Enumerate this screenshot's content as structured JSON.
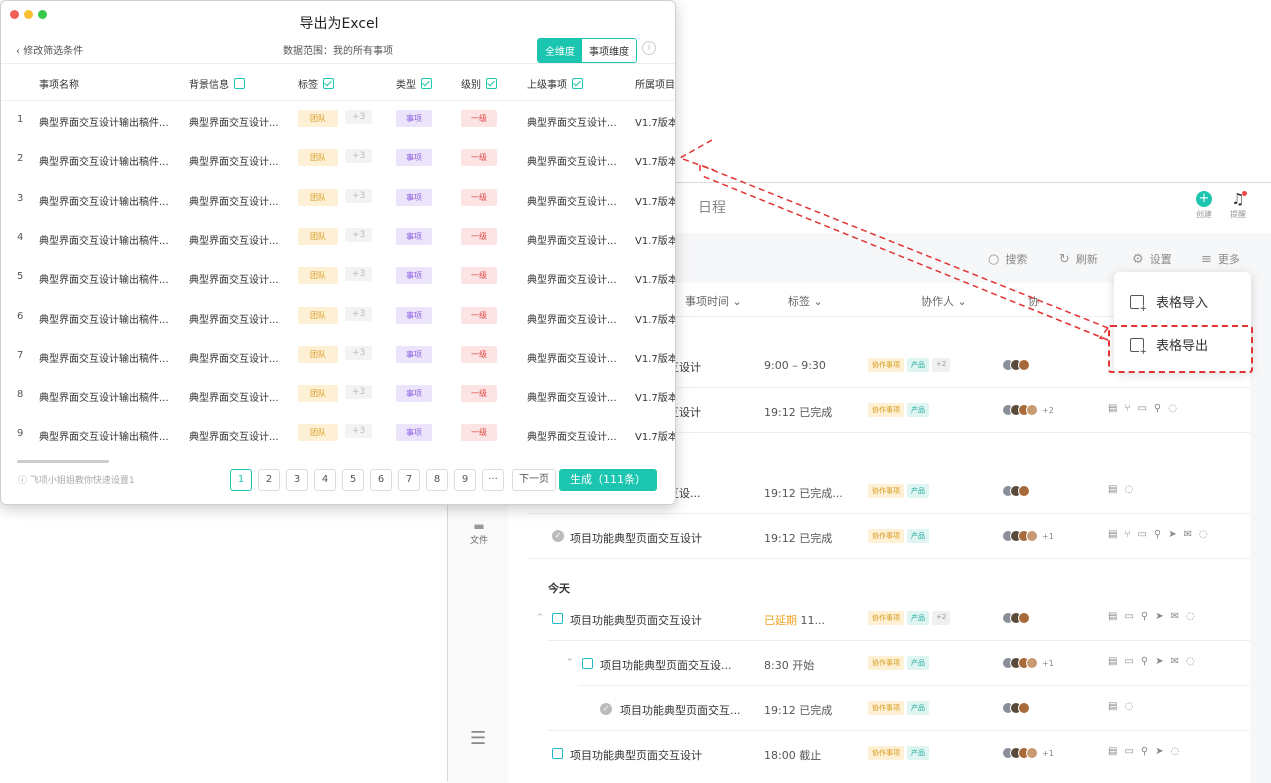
{
  "dialog": {
    "title": "导出为Excel",
    "back_label": "修改筛选条件",
    "range_label": "数据范围：我的所有事项",
    "seg_all": "全维度",
    "seg_item": "事项维度",
    "headers": [
      "事项名称",
      "背景信息",
      "标签",
      "类型",
      "级别",
      "上级事项",
      "所属项目"
    ],
    "rows": [
      {
        "n": "1",
        "name": "典型界面交互设计输出稿件...",
        "bg": "典型界面交互设计...",
        "tag1": "团队",
        "tag2": "+3",
        "type": "事项",
        "level": "一级",
        "parent": "典型界面交互设计...",
        "proj": "V1.7版本"
      },
      {
        "n": "2",
        "name": "典型界面交互设计输出稿件...",
        "bg": "典型界面交互设计...",
        "tag1": "团队",
        "tag2": "+3",
        "type": "事项",
        "level": "一级",
        "parent": "典型界面交互设计...",
        "proj": "V1.7版本"
      },
      {
        "n": "3",
        "name": "典型界面交互设计输出稿件...",
        "bg": "典型界面交互设计...",
        "tag1": "团队",
        "tag2": "+3",
        "type": "事项",
        "level": "一级",
        "parent": "典型界面交互设计...",
        "proj": "V1.7版本"
      },
      {
        "n": "4",
        "name": "典型界面交互设计输出稿件...",
        "bg": "典型界面交互设计...",
        "tag1": "团队",
        "tag2": "+3",
        "type": "事项",
        "level": "一级",
        "parent": "典型界面交互设计...",
        "proj": "V1.7版本"
      },
      {
        "n": "5",
        "name": "典型界面交互设计输出稿件...",
        "bg": "典型界面交互设计...",
        "tag1": "团队",
        "tag2": "+3",
        "type": "事项",
        "level": "一级",
        "parent": "典型界面交互设计...",
        "proj": "V1.7版本"
      },
      {
        "n": "6",
        "name": "典型界面交互设计输出稿件...",
        "bg": "典型界面交互设计...",
        "tag1": "团队",
        "tag2": "+3",
        "type": "事项",
        "level": "一级",
        "parent": "典型界面交互设计...",
        "proj": "V1.7版本"
      },
      {
        "n": "7",
        "name": "典型界面交互设计输出稿件...",
        "bg": "典型界面交互设计...",
        "tag1": "团队",
        "tag2": "+3",
        "type": "事项",
        "level": "一级",
        "parent": "典型界面交互设计...",
        "proj": "V1.7版本"
      },
      {
        "n": "8",
        "name": "典型界面交互设计输出稿件...",
        "bg": "典型界面交互设计...",
        "tag1": "团队",
        "tag2": "+3",
        "type": "事项",
        "level": "一级",
        "parent": "典型界面交互设计...",
        "proj": "V1.7版本"
      },
      {
        "n": "9",
        "name": "典型界面交互设计输出稿件...",
        "bg": "典型界面交互设计...",
        "tag1": "团队",
        "tag2": "+3",
        "type": "事项",
        "level": "一级",
        "parent": "典型界面交互设计...",
        "proj": "V1.7版本"
      }
    ],
    "tip": "飞项小姐姐教你快速设置1",
    "pages": [
      "1",
      "2",
      "3",
      "4",
      "5",
      "6",
      "7",
      "8",
      "9",
      "···",
      "下一页"
    ],
    "generate_label": "生成（111条）"
  },
  "app": {
    "nav_schedule": "日程",
    "create_label": "创建",
    "remind_label": "提醒",
    "search_label": "搜索",
    "refresh_label": "刷新",
    "settings_label": "设置",
    "more_label": "更多",
    "col_time": "事项时间 ⌄",
    "col_tag": "标签 ⌄",
    "col_collab": "协作人 ⌄",
    "col_extra": "协",
    "file_label": "文件",
    "today_label": "今天",
    "menu": {
      "import": "表格导入",
      "export": "表格导出"
    },
    "tag_collab": "协作事项",
    "tag_product": "产品",
    "rows": [
      {
        "name": "互设计",
        "time": "9:00 – 9:30"
      },
      {
        "name": "互设计",
        "time": "19:12 已完成"
      },
      {
        "name": "互设...",
        "time": "19:12 已完成..."
      },
      {
        "name": "项目功能典型页面交互设计",
        "time": "19:12 已完成"
      },
      {
        "name": "项目功能典型页面交互设计",
        "time_late": "已延期",
        "time": "11..."
      },
      {
        "name": "项目功能典型页面交互设...",
        "time": "8:30 开始"
      },
      {
        "name": "项目功能典型页面交互...",
        "time": "19:12 已完成"
      },
      {
        "name": "项目功能典型页面交互设计",
        "time": "18:00 截止"
      }
    ],
    "plus": {
      "p2": "+2",
      "p1": "+1"
    }
  },
  "colors": {
    "accent": "#1bc5b0",
    "danger": "#e23333"
  }
}
